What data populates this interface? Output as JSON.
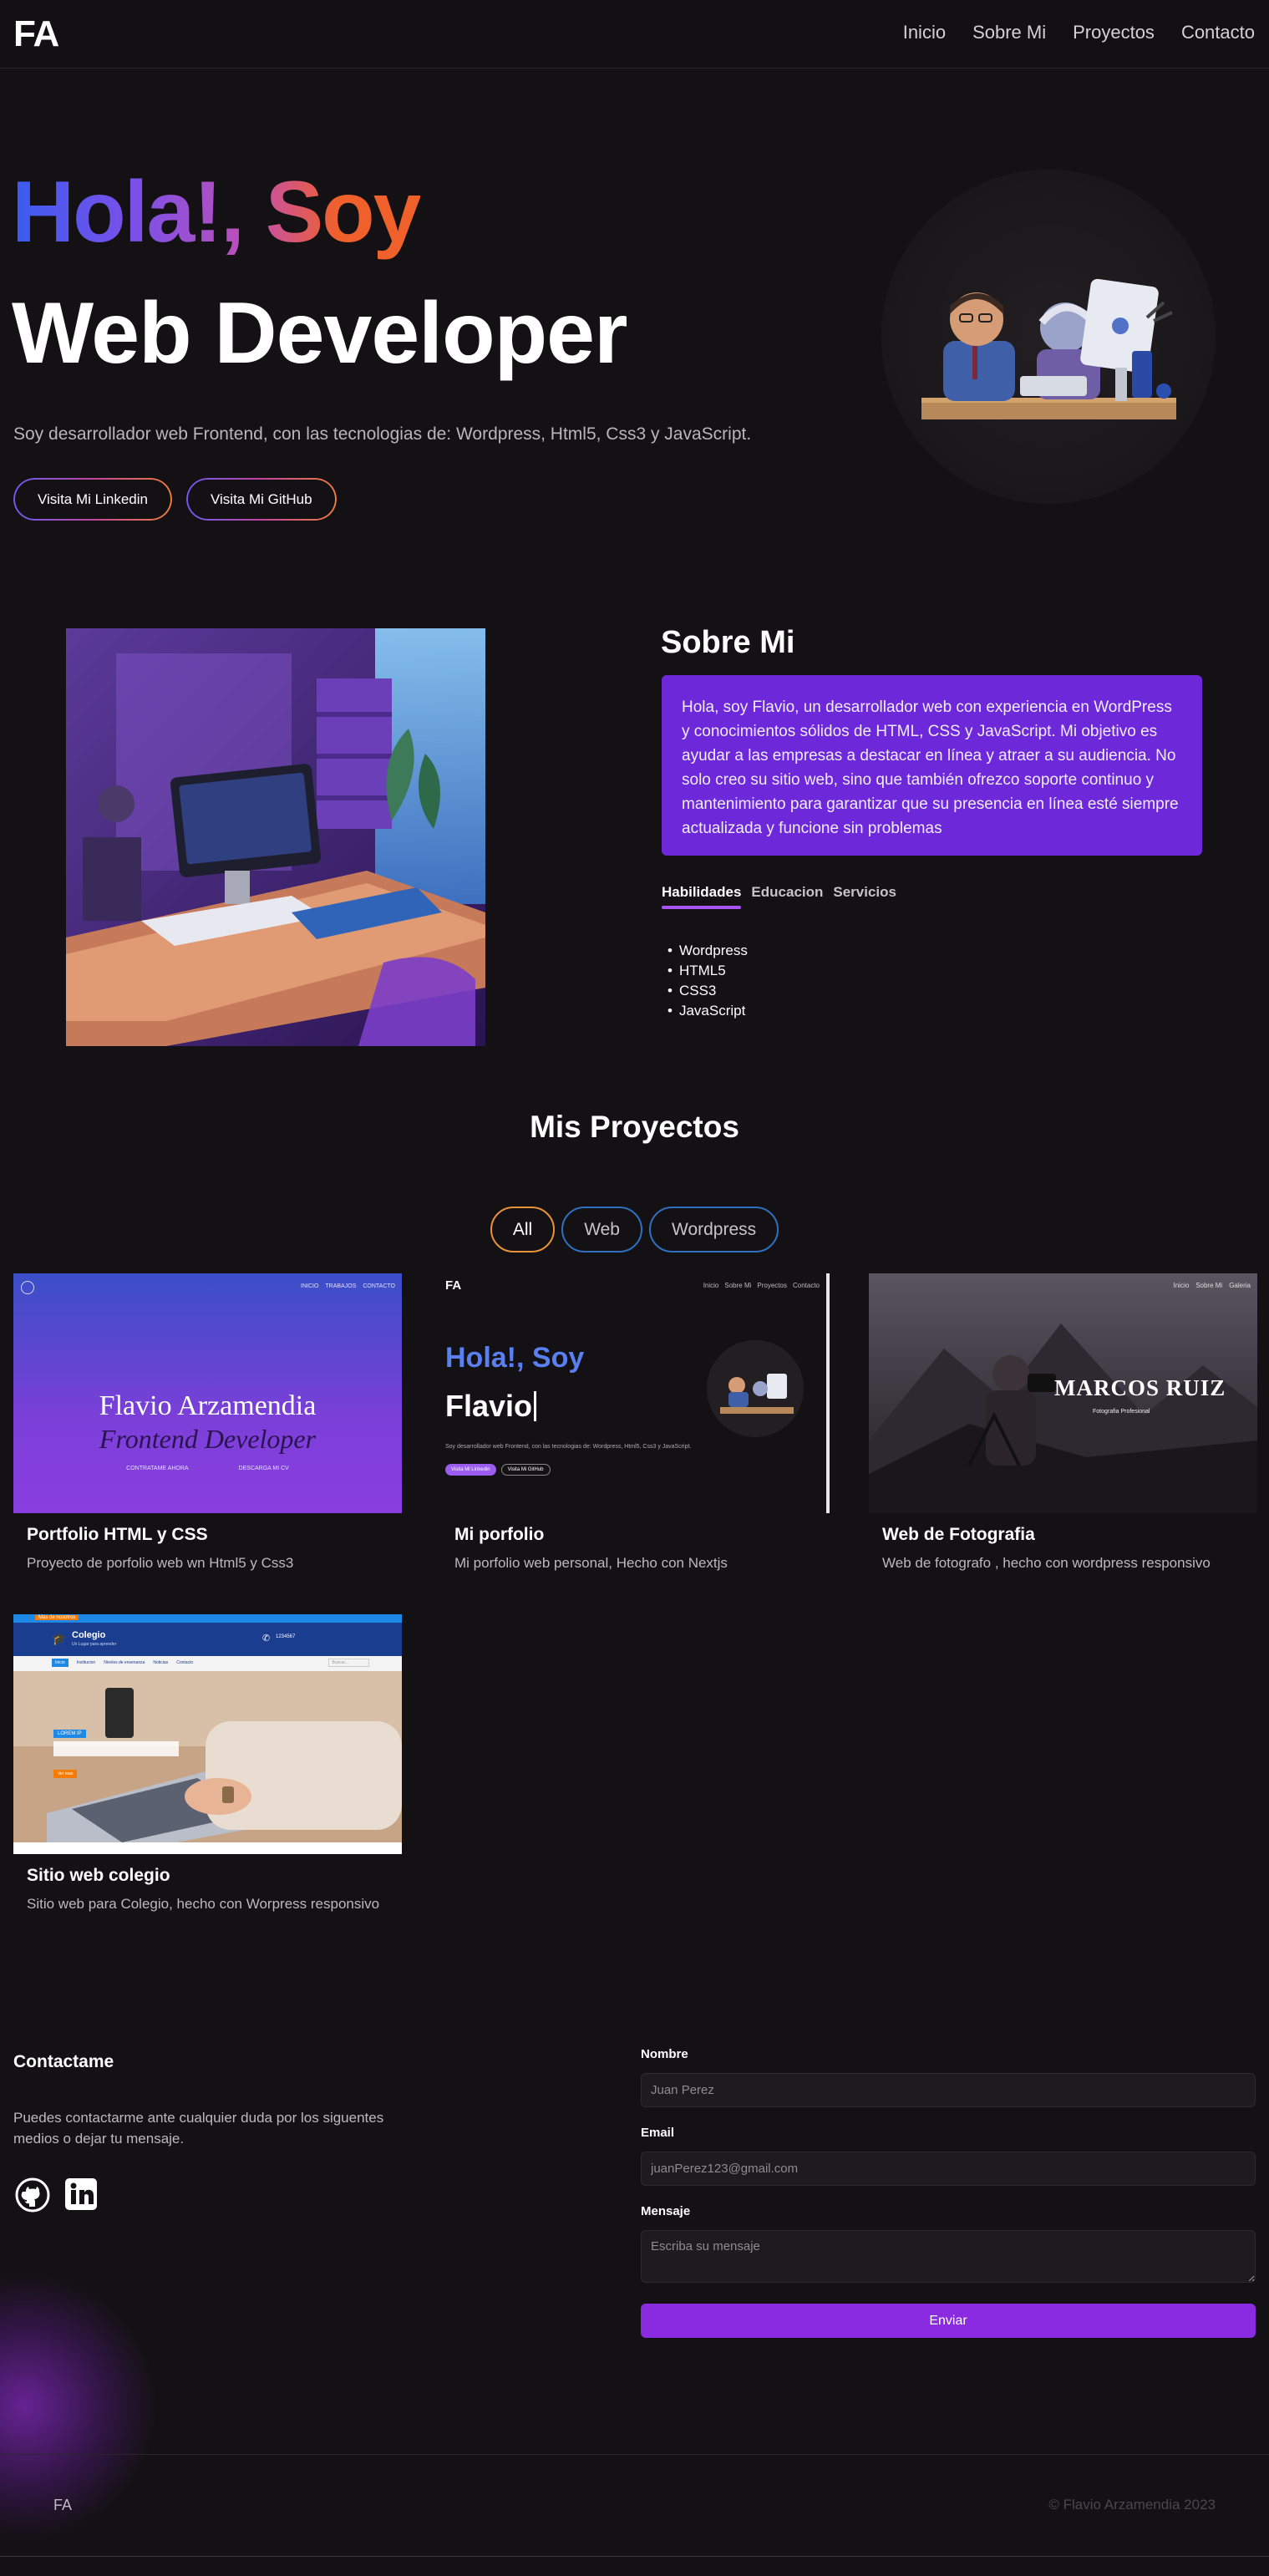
{
  "nav": {
    "logo": "FA",
    "links": [
      "Inicio",
      "Sobre Mi",
      "Proyectos",
      "Contacto"
    ]
  },
  "hero": {
    "greeting": "Hola!, Soy",
    "title": "Web Developer",
    "description": "Soy desarrollador web Frontend, con las tecnologias de: Wordpress, Html5, Css3 y JavaScript.",
    "buttons": [
      "Visita Mi Linkedin",
      "Visita Mi GitHub"
    ]
  },
  "about": {
    "title": "Sobre Mi",
    "text": "Hola, soy Flavio, un desarrollador web con experiencia en WordPress y conocimientos sólidos de HTML, CSS y JavaScript. Mi objetivo es ayudar a las empresas a destacar en línea y atraer a su audiencia. No solo creo su sitio web, sino que también ofrezco soporte continuo y mantenimiento para garantizar que su presencia en línea esté siempre actualizada y funcione sin problemas",
    "tabs": [
      "Habilidades",
      "Educacion",
      "Servicios"
    ],
    "skills": [
      "Wordpress",
      "HTML5",
      "CSS3",
      "JavaScript"
    ]
  },
  "projects": {
    "title": "Mis Proyectos",
    "filters": [
      "All",
      "Web",
      "Wordpress"
    ],
    "items": [
      {
        "title": "Portfolio HTML y CSS",
        "description": "Proyecto de porfolio web wn Html5 y Css3",
        "thumb": {
          "nav": [
            "INICIO",
            "TRABAJOS",
            "CONTACTO"
          ],
          "name": "Flavio Arzamendia",
          "role": "Frontend Developer",
          "links": [
            "CONTRATAME AHORA",
            "DESCARGA MI CV"
          ]
        }
      },
      {
        "title": "Mi porfolio",
        "description": "Mi porfolio web personal, Hecho con Nextjs",
        "thumb": {
          "logo": "FA",
          "nav": [
            "Inicio",
            "Sobre Mi",
            "Proyectos",
            "Contacto"
          ],
          "greeting": "Hola!, Soy",
          "name": "Flavio",
          "text": "Soy desarrollador web Frontend, con las tecnologias de: Wordpress, Html5, Css3 y JavaScript.",
          "buttons": [
            "Visita Mi Linkedin",
            "Visita Mi GitHub"
          ]
        }
      },
      {
        "title": "Web de Fotografia",
        "description": "Web de fotografo , hecho con wordpress responsivo",
        "thumb": {
          "nav": [
            "Inicio",
            "Sobre Mi",
            "Galeria"
          ],
          "name": "MARCOS RUIZ",
          "subtitle": "Fotografia Profesional"
        }
      },
      {
        "title": "Sitio web colegio",
        "description": "Sitio web para Colegio, hecho con Worpress responsivo",
        "thumb": {
          "top_link": "Más de nosotros",
          "brand": "Colegio",
          "brand_sub": "Un Lugar para aprender",
          "phone": "1234567",
          "menu": [
            "Inicio",
            "Institucion",
            "Niveles de ensenanza",
            "Noticias",
            "Contacto"
          ],
          "search": "Buscar...",
          "badge": "LOREM IP",
          "button": "Ver mas"
        }
      }
    ]
  },
  "contact": {
    "title": "Contactame",
    "description": "Puedes contactarme ante cualquier duda por los siguentes medios o dejar tu mensaje.",
    "form": {
      "name_label": "Nombre",
      "name_placeholder": "Juan Perez",
      "email_label": "Email",
      "email_placeholder": "juanPerez123@gmail.com",
      "message_label": "Mensaje",
      "message_placeholder": "Escriba su mensaje",
      "submit": "Enviar"
    }
  },
  "footer": {
    "logo": "FA",
    "copyright": "© Flavio Arzamendia 2023"
  }
}
